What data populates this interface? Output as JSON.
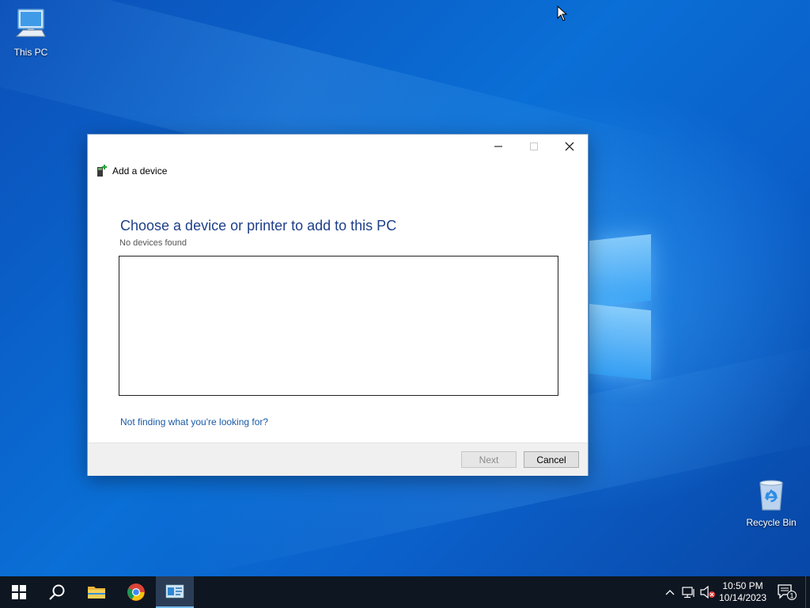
{
  "desktop": {
    "icons": [
      {
        "label": "This PC",
        "icon": "this-pc-icon"
      },
      {
        "label": "Recycle Bin",
        "icon": "recycle-bin-icon"
      }
    ]
  },
  "dialog": {
    "window_title": "Add a device",
    "heading": "Choose a device or printer to add to this PC",
    "status": "No devices found",
    "device_list": [],
    "help_link": "Not finding what you're looking for?",
    "buttons": {
      "next": "Next",
      "cancel": "Cancel"
    },
    "next_enabled": false
  },
  "taskbar": {
    "pinned": [
      {
        "name": "start",
        "icon": "windows-start-icon"
      },
      {
        "name": "search",
        "icon": "search-icon"
      },
      {
        "name": "file-explorer",
        "icon": "folder-icon"
      },
      {
        "name": "chrome",
        "icon": "chrome-icon"
      },
      {
        "name": "add-device",
        "icon": "device-window-icon",
        "active": true
      }
    ],
    "tray": {
      "time": "10:50 PM",
      "date": "10/14/2023",
      "notification_count": "1"
    }
  },
  "colors": {
    "taskbar": "#0e1621",
    "heading": "#1e3f8a",
    "link": "#1a5aa6",
    "accent": "#76b9ed"
  }
}
